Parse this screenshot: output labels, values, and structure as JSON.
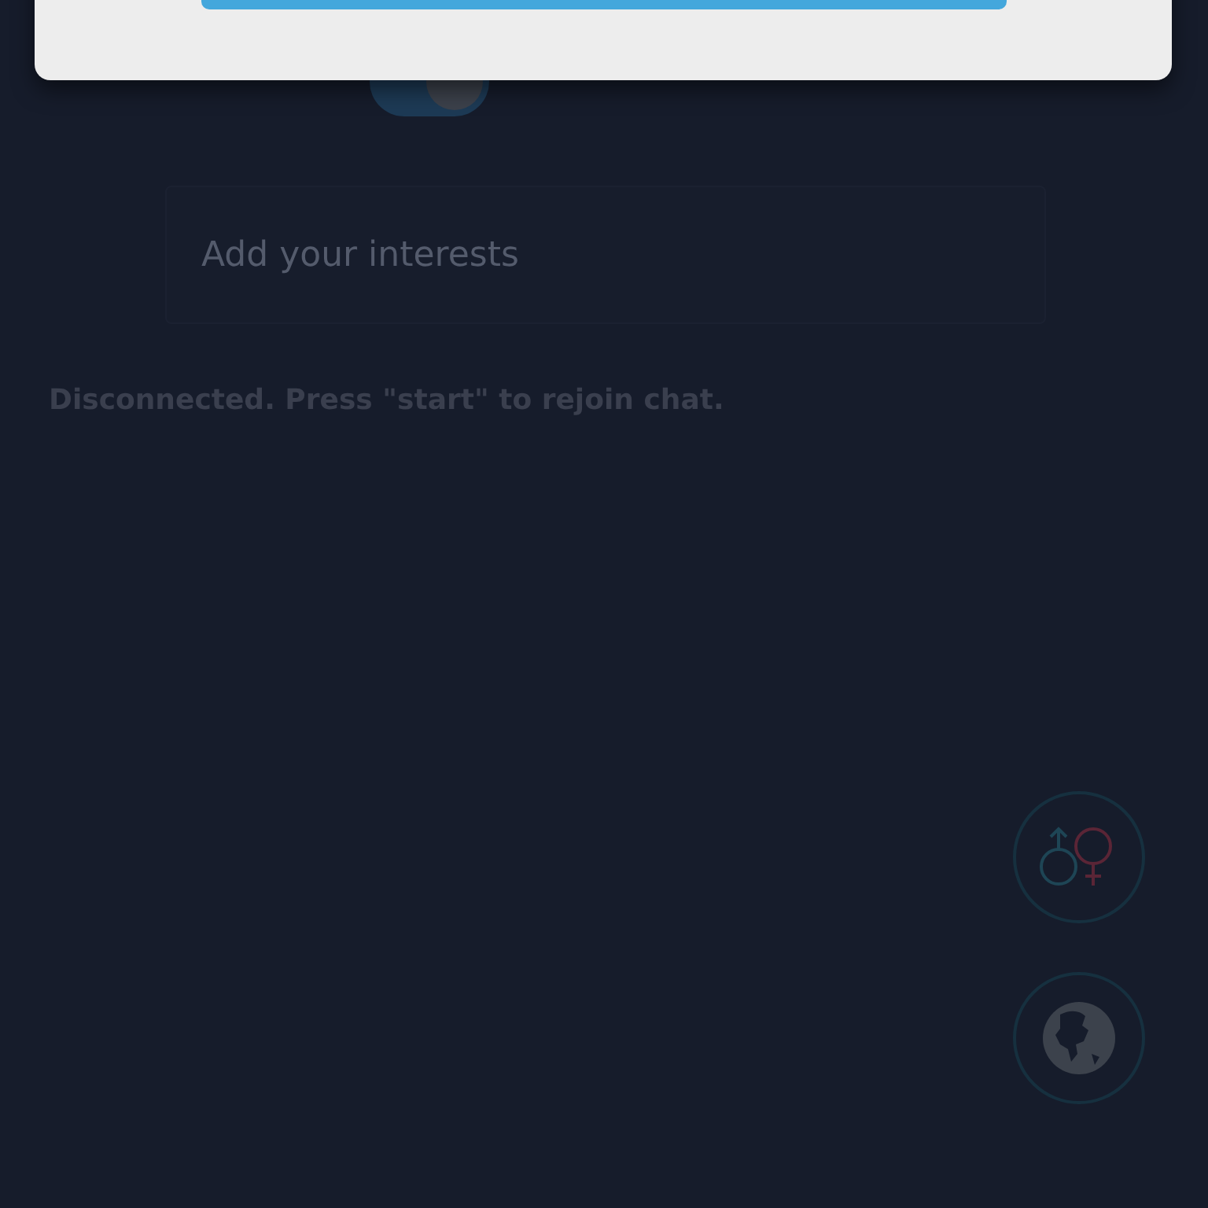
{
  "toggle": {
    "on": true
  },
  "interests": {
    "placeholder": "Add your interests"
  },
  "status": "Disconnected. Press \"start\" to rejoin chat.",
  "fab_buttons": [
    {
      "kind": "gender"
    },
    {
      "kind": "globe"
    }
  ]
}
